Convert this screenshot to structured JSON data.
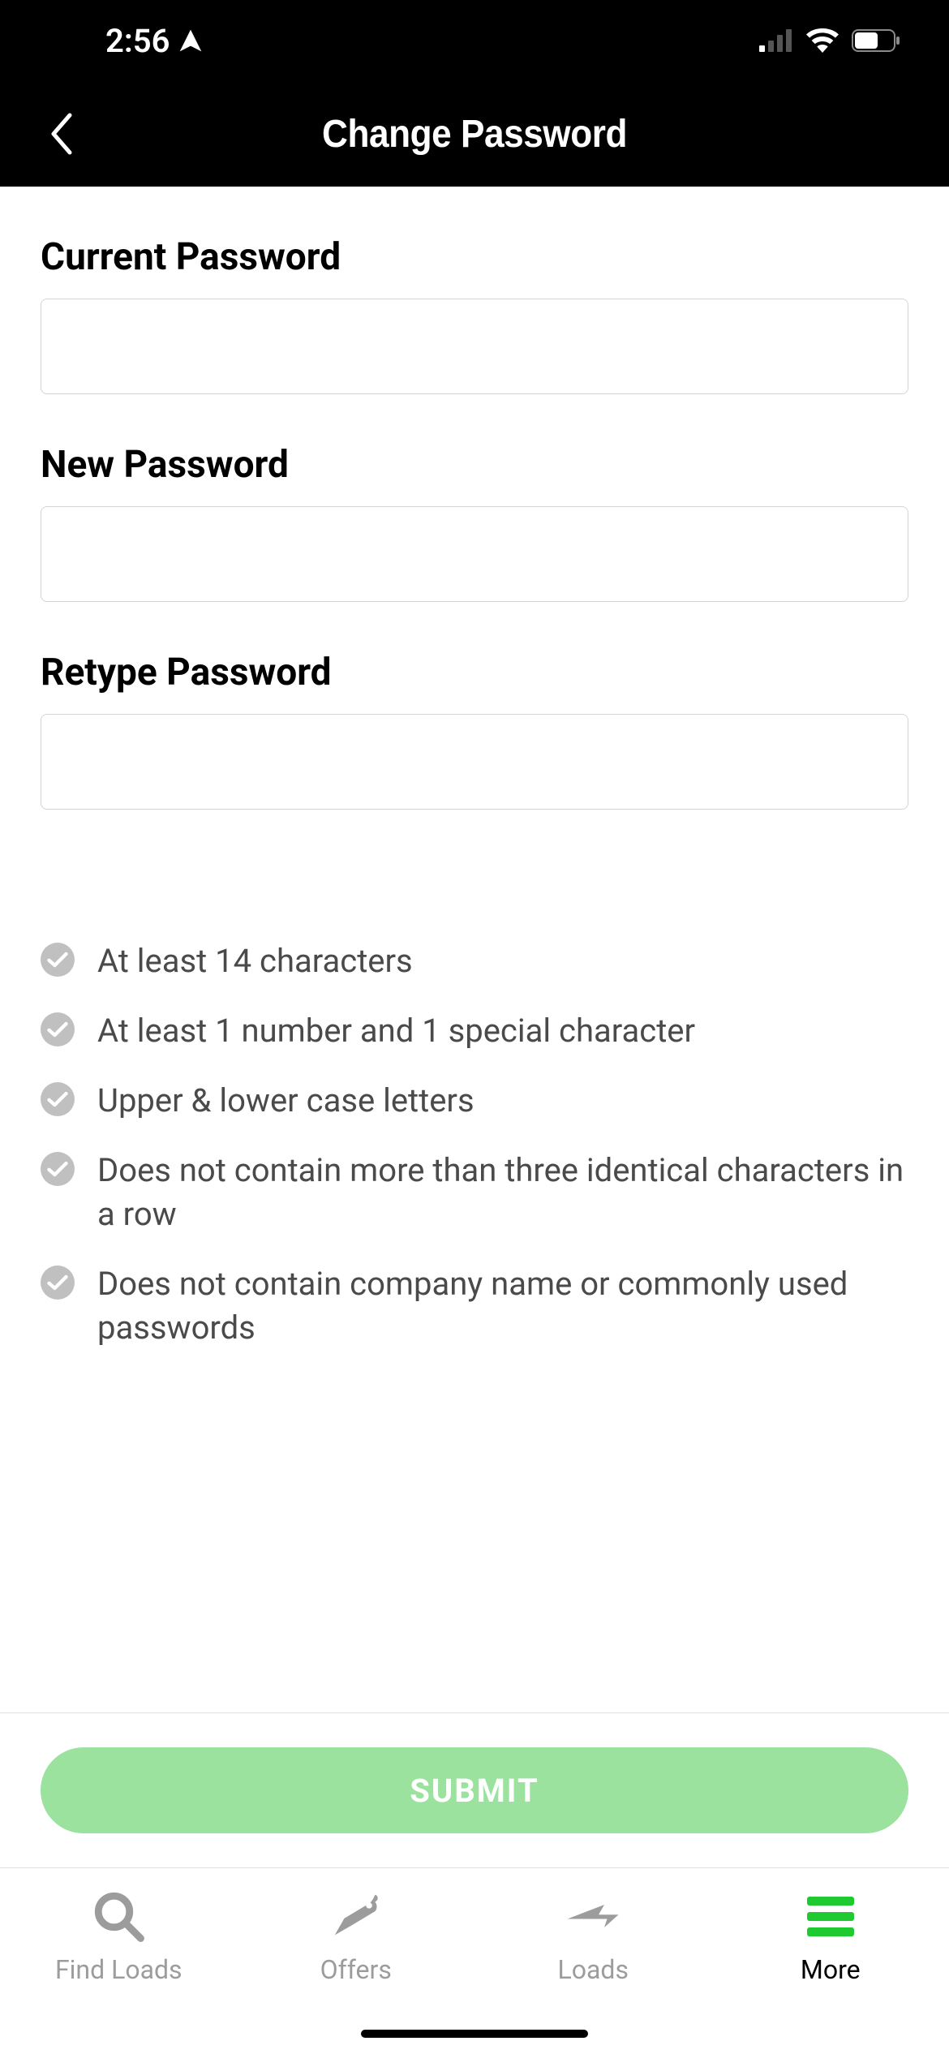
{
  "status": {
    "time": "2:56"
  },
  "header": {
    "title": "Change Password"
  },
  "fields": {
    "current": {
      "label": "Current Password",
      "value": ""
    },
    "new": {
      "label": "New Password",
      "value": ""
    },
    "retype": {
      "label": "Retype Password",
      "value": ""
    }
  },
  "rules": [
    "At least 14 characters",
    "At least 1 number and 1 special character",
    "Upper & lower case letters",
    "Does not contain more than three identical characters in a row",
    "Does not contain company name or commonly used passwords"
  ],
  "submit": {
    "label": "SUBMIT"
  },
  "tabs": [
    {
      "label": "Find Loads",
      "icon": "search-icon",
      "active": false
    },
    {
      "label": "Offers",
      "icon": "tag-icon",
      "active": false
    },
    {
      "label": "Loads",
      "icon": "arrow-icon",
      "active": false
    },
    {
      "label": "More",
      "icon": "menu-icon",
      "active": true
    }
  ]
}
